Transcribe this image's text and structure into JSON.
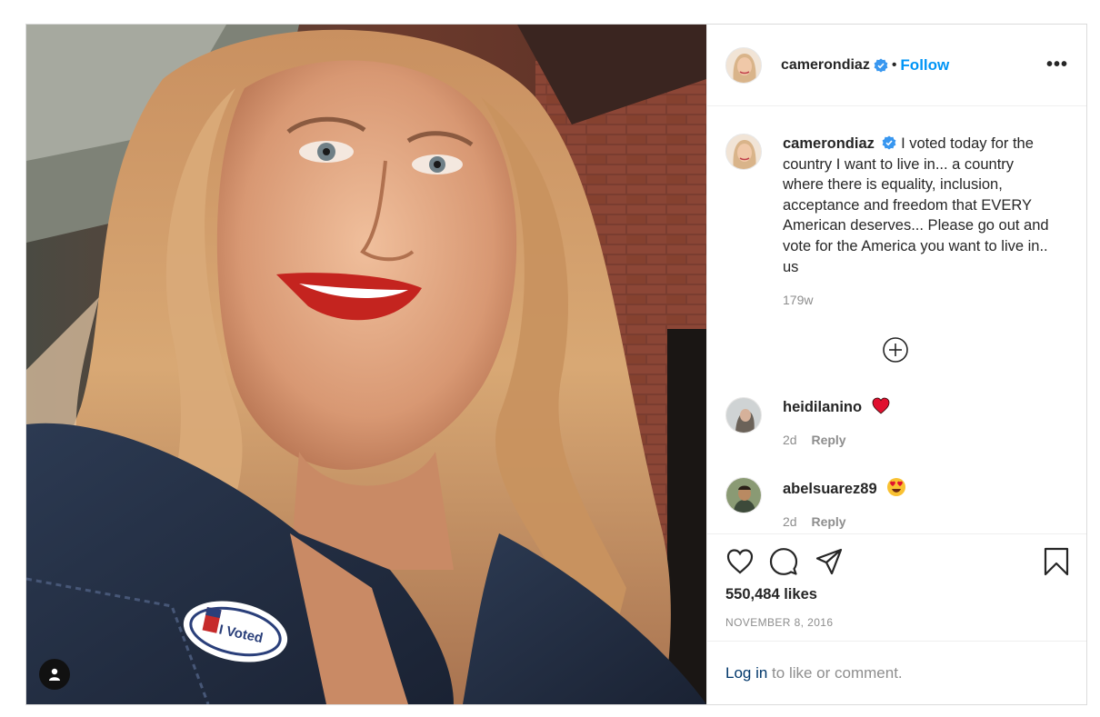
{
  "post": {
    "username": "camerondiaz",
    "follow_label": "Follow",
    "separator": "•",
    "more_label": "•••",
    "photo": {
      "sticker_text": "I Voted"
    },
    "caption": {
      "username": "camerondiaz",
      "text": "I voted today for the country I want to live in... a country where there is equality, inclusion, acceptance and freedom that EVERY American deserves... Please go out and vote for the America you want to live in.. us",
      "time_ago": "179w"
    },
    "comments": [
      {
        "username": "heidilanino",
        "emoji": "heart",
        "age": "2d",
        "reply_label": "Reply"
      },
      {
        "username": "abelsuarez89",
        "emoji": "heart-eyes",
        "age": "2d",
        "reply_label": "Reply"
      }
    ],
    "likes": "550,484 likes",
    "date": "NOVEMBER 8, 2016",
    "login": {
      "link": "Log in",
      "rest": " to like or comment."
    }
  },
  "colors": {
    "accent": "#0095f6",
    "verified": "#3897f0",
    "secondary_text": "#8e8e8e",
    "link": "#00376b"
  }
}
